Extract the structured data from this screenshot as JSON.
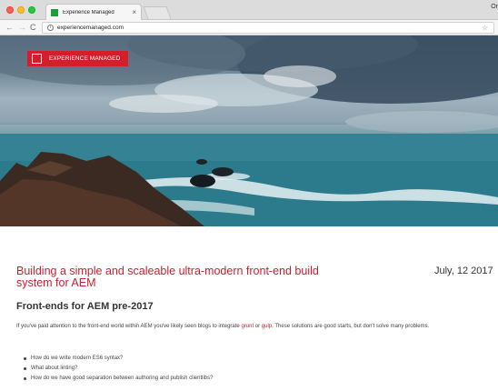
{
  "browser": {
    "tab_title": "Experience Managed",
    "tab_close": "×",
    "profile_label": "Or",
    "url": "experiencemanaged.com",
    "icons": [
      "back-arrow-icon",
      "forward-arrow-icon",
      "reload-icon",
      "info-icon",
      "bookmark-star-icon"
    ]
  },
  "site": {
    "brand": "EXPERIENCE MANAGED",
    "brand_color": "#d41e2c"
  },
  "article": {
    "title": "Building a simple and scaleable ultra-modern front-end build system for AEM",
    "date": "July, 12 2017",
    "subtitle": "Front-ends for AEM pre-2017",
    "para_before": "If you've paid attention to the front-end world within AEM you've likely seen blogs to integrate ",
    "link_grunt": "grunt",
    "para_or": " or ",
    "link_gulp": "gulp",
    "para_after": ". These solutions are good starts, but don't solve many problems.",
    "bullets": [
      "How do we write modern ES6 syntax?",
      "What about linting?",
      "How do we have good separation between authoring and publish clientlibs?"
    ]
  }
}
